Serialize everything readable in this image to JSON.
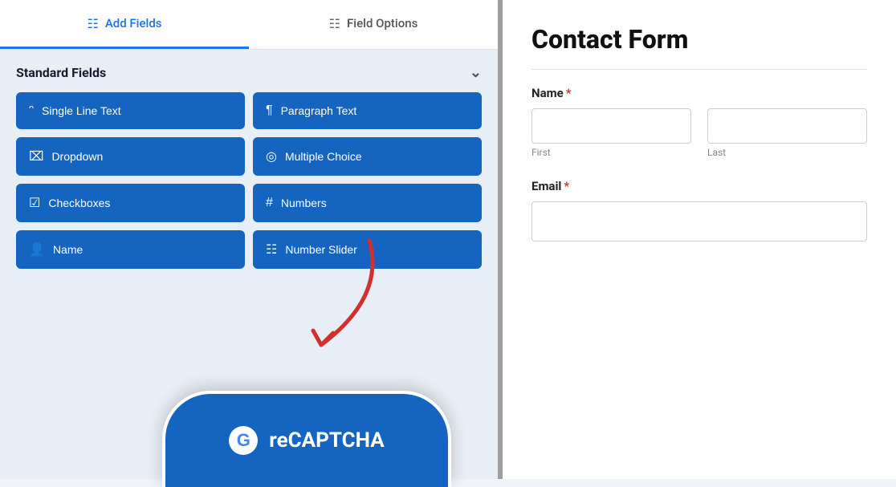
{
  "tabs": [
    {
      "id": "add-fields",
      "label": "Add Fields",
      "icon": "☰",
      "active": true
    },
    {
      "id": "field-options",
      "label": "Field Options",
      "icon": "⚙",
      "active": false
    }
  ],
  "sidebar": {
    "section_label": "Standard Fields",
    "fields": [
      {
        "id": "single-line-text",
        "icon": "T",
        "label": "Single Line Text"
      },
      {
        "id": "paragraph-text",
        "icon": "¶",
        "label": "Paragraph Text"
      },
      {
        "id": "dropdown",
        "icon": "⊟",
        "label": "Dropdown"
      },
      {
        "id": "multiple-choice",
        "icon": "◎",
        "label": "Multiple Choice"
      },
      {
        "id": "checkboxes",
        "icon": "☑",
        "label": "Checkboxes"
      },
      {
        "id": "numbers",
        "icon": "#",
        "label": "Numbers"
      },
      {
        "id": "name",
        "icon": "👤",
        "label": "Name"
      },
      {
        "id": "number-slider",
        "icon": "⚙",
        "label": "Number Slider"
      }
    ],
    "recaptcha_label": "reCAPTCHA"
  },
  "form": {
    "title": "Contact Form",
    "name_label": "Name",
    "name_required": true,
    "first_sublabel": "First",
    "last_sublabel": "Last",
    "email_label": "Email",
    "email_required": true
  }
}
